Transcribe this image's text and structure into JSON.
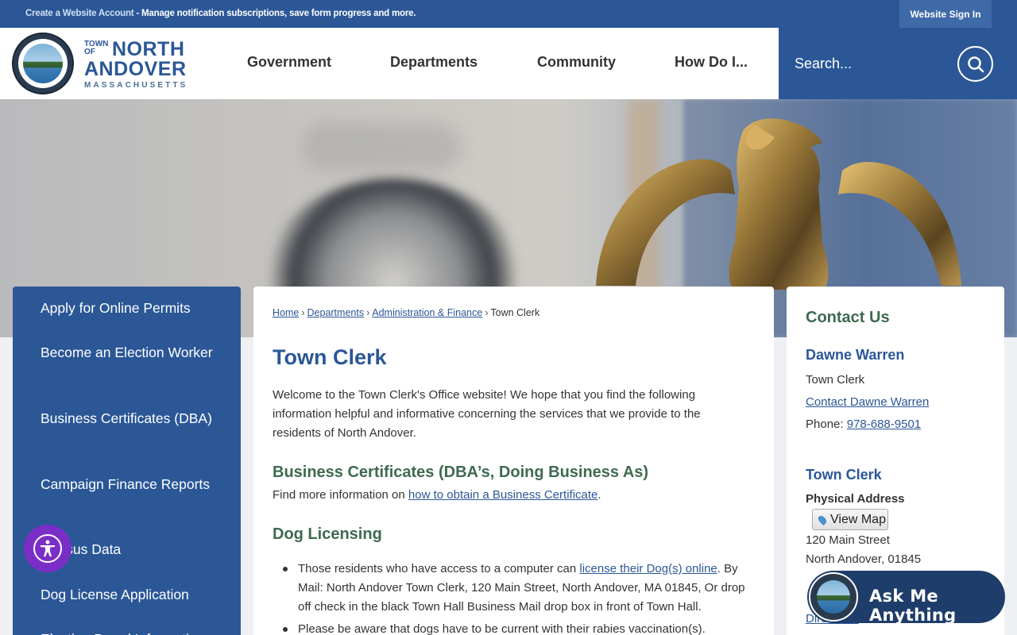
{
  "topbar": {
    "account_link": "Create a Website Account",
    "account_rest": " - Manage notification subscriptions, save form progress and more.",
    "signin": "Website Sign In"
  },
  "logo": {
    "town_of": "TOWN OF",
    "north": "NORTH",
    "andover": "ANDOVER",
    "state": "MASSACHUSETTS"
  },
  "nav": [
    "Government",
    "Departments",
    "Community",
    "How Do I..."
  ],
  "search": {
    "placeholder": "Search..."
  },
  "sidebar": {
    "items": [
      "Apply for Online Permits",
      "Become an Election Worker",
      "Business Certificates (DBA)",
      "Campaign Finance Reports",
      "Census Data",
      "Dog License Application",
      "Election Board Information"
    ]
  },
  "breadcrumb": [
    "Home",
    "Departments",
    "Administration & Finance",
    "Town Clerk"
  ],
  "main": {
    "title": "Town Clerk",
    "intro": "Welcome to the Town Clerk's Office website! We hope that you find the following information helpful and informative concerning the services that we provide to the residents of North Andover.",
    "section1_heading": "Business Certificates (DBA’s, Doing Business As)",
    "section1_text": "Find more information on ",
    "section1_link": "how to obtain a Business Certificate",
    "section1_end": ".",
    "section2_heading": "Dog Licensing",
    "bullet1_pre": "Those residents who have access to a computer can ",
    "bullet1_link": "license their Dog(s) online",
    "bullet1_post": ". By Mail: North Andover Town Clerk, 120 Main Street, North Andover, MA 01845, Or drop off check in the black Town Hall Business Mail drop box in front of Town Hall.",
    "bullet2": "Please be aware that dogs have to be current with their rabies vaccination(s)."
  },
  "contact": {
    "title": "Contact Us",
    "person_name": "Dawne Warren",
    "person_role": "Town Clerk",
    "contact_link": "Contact Dawne Warren",
    "phone_label": "Phone: ",
    "phone": "978-688-9501",
    "office_name": "Town Clerk",
    "address_label": "Physical Address",
    "view_map": "View Map",
    "street": "120 Main Street",
    "city": "North Andover, 01845",
    "directions": "Directions"
  },
  "ask": {
    "label": "Ask Me Anything"
  },
  "colors": {
    "primary": "#2b5797",
    "accent_green": "#3e6a4f",
    "accessibility": "#7b2ec7"
  }
}
